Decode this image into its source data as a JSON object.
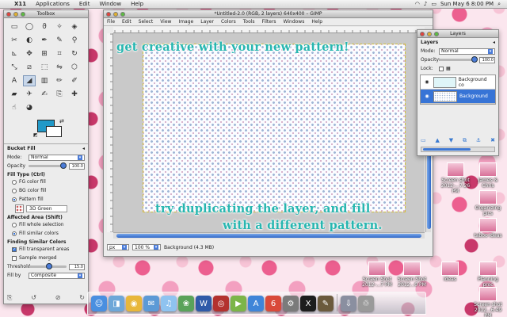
{
  "menubar": {
    "apple": "",
    "items": [
      "X11",
      "Applications",
      "Edit",
      "Window",
      "Help"
    ],
    "clock": "Sun May 6  8:00 PM",
    "status_icons": [
      "wifi-icon",
      "volume-icon",
      "battery-icon",
      "search-icon"
    ]
  },
  "toolbox": {
    "title": "Toolbox",
    "tools": [
      "rect-select-icon",
      "ellipse-select-icon",
      "lasso-icon",
      "fuzzy-select-icon",
      "color-select-icon",
      "scissors-icon",
      "foreground-select-icon",
      "paths-icon",
      "color-picker-icon",
      "zoom-icon",
      "measure-icon",
      "move-icon",
      "align-icon",
      "crop-icon",
      "rotate-icon",
      "scale-icon",
      "shear-icon",
      "perspective-icon",
      "flip-icon",
      "cage-icon",
      "text-icon",
      "bucket-fill-icon",
      "blend-icon",
      "pencil-icon",
      "paintbrush-icon",
      "eraser-icon",
      "airbrush-icon",
      "ink-icon",
      "clone-icon",
      "heal-icon",
      "smudge-icon",
      "dodge-burn-icon"
    ],
    "options_title": "Bucket Fill",
    "mode_label": "Mode:",
    "mode_value": "Normal",
    "opacity_label": "Opacity",
    "opacity_value": "100.0",
    "fill_type_label": "Fill Type  (Ctrl)",
    "fill_fg": "FG color fill",
    "fill_bg": "BG color fill",
    "fill_pattern": "Pattern fill",
    "pattern_name": "3D Green",
    "affected_label": "Affected Area  (Shift)",
    "affected_whole": "Fill whole selection",
    "affected_similar": "Fill similar colors",
    "finding_label": "Finding Similar Colors",
    "fill_transparent": "Fill transparent areas",
    "sample_merged": "Sample merged",
    "threshold_label": "Threshold",
    "threshold_value": "15.0",
    "fill_by_label": "Fill by",
    "fill_by_value": "Composite",
    "opacity_fraction": 0.92,
    "threshold_fraction": 0.06
  },
  "gimp": {
    "title": "*Untitled-2.0 (RGB, 2 layers) 640x400 – GIMP",
    "menus": [
      "File",
      "Edit",
      "Select",
      "View",
      "Image",
      "Layer",
      "Colors",
      "Tools",
      "Filters",
      "Windows",
      "Help"
    ],
    "unit": "px",
    "zoom": "100 %",
    "status": "Background (4.3 MB)"
  },
  "overlay": {
    "line1": "get creative with your new pattern!",
    "line2": "try duplicating the layer, and fill",
    "line3": "with a different pattern."
  },
  "layers": {
    "title": "Layers",
    "panel_label": "Layers",
    "mode_label": "Mode:",
    "mode_value": "Normal",
    "opacity_label": "Opacity:",
    "opacity_value": "100.0",
    "lock_label": "Lock:",
    "items": [
      {
        "name": "Background co",
        "selected": false
      },
      {
        "name": "Background",
        "selected": true
      }
    ]
  },
  "desktop": {
    "icons": [
      "Screen shot 2012-...7.26 PM",
      "James & Chris",
      "Organizing pics",
      "taboo ideas",
      "Screen Shot 2012-...7 PM",
      "Planning proc",
      "ideas",
      "Screen Shot 2012...0 PM",
      "Screen shot 2012...6.49 PM"
    ]
  },
  "dock": {
    "icons": [
      "finder-icon",
      "preview-icon",
      "chrome-icon",
      "mail-icon",
      "itunes-icon",
      "iphoto-icon",
      "word-icon",
      "photobooth-icon",
      "facetime-icon",
      "app-store-icon",
      "ical-icon",
      "system-prefs-icon",
      "x11-icon",
      "gimp-icon",
      "downloads-icon",
      "trash-icon"
    ]
  },
  "colors": {
    "accent": "#2f6fd6",
    "overlay_text": "#27b6b0",
    "fg_color": "#2199c8",
    "bg_color": "#ffffff"
  }
}
